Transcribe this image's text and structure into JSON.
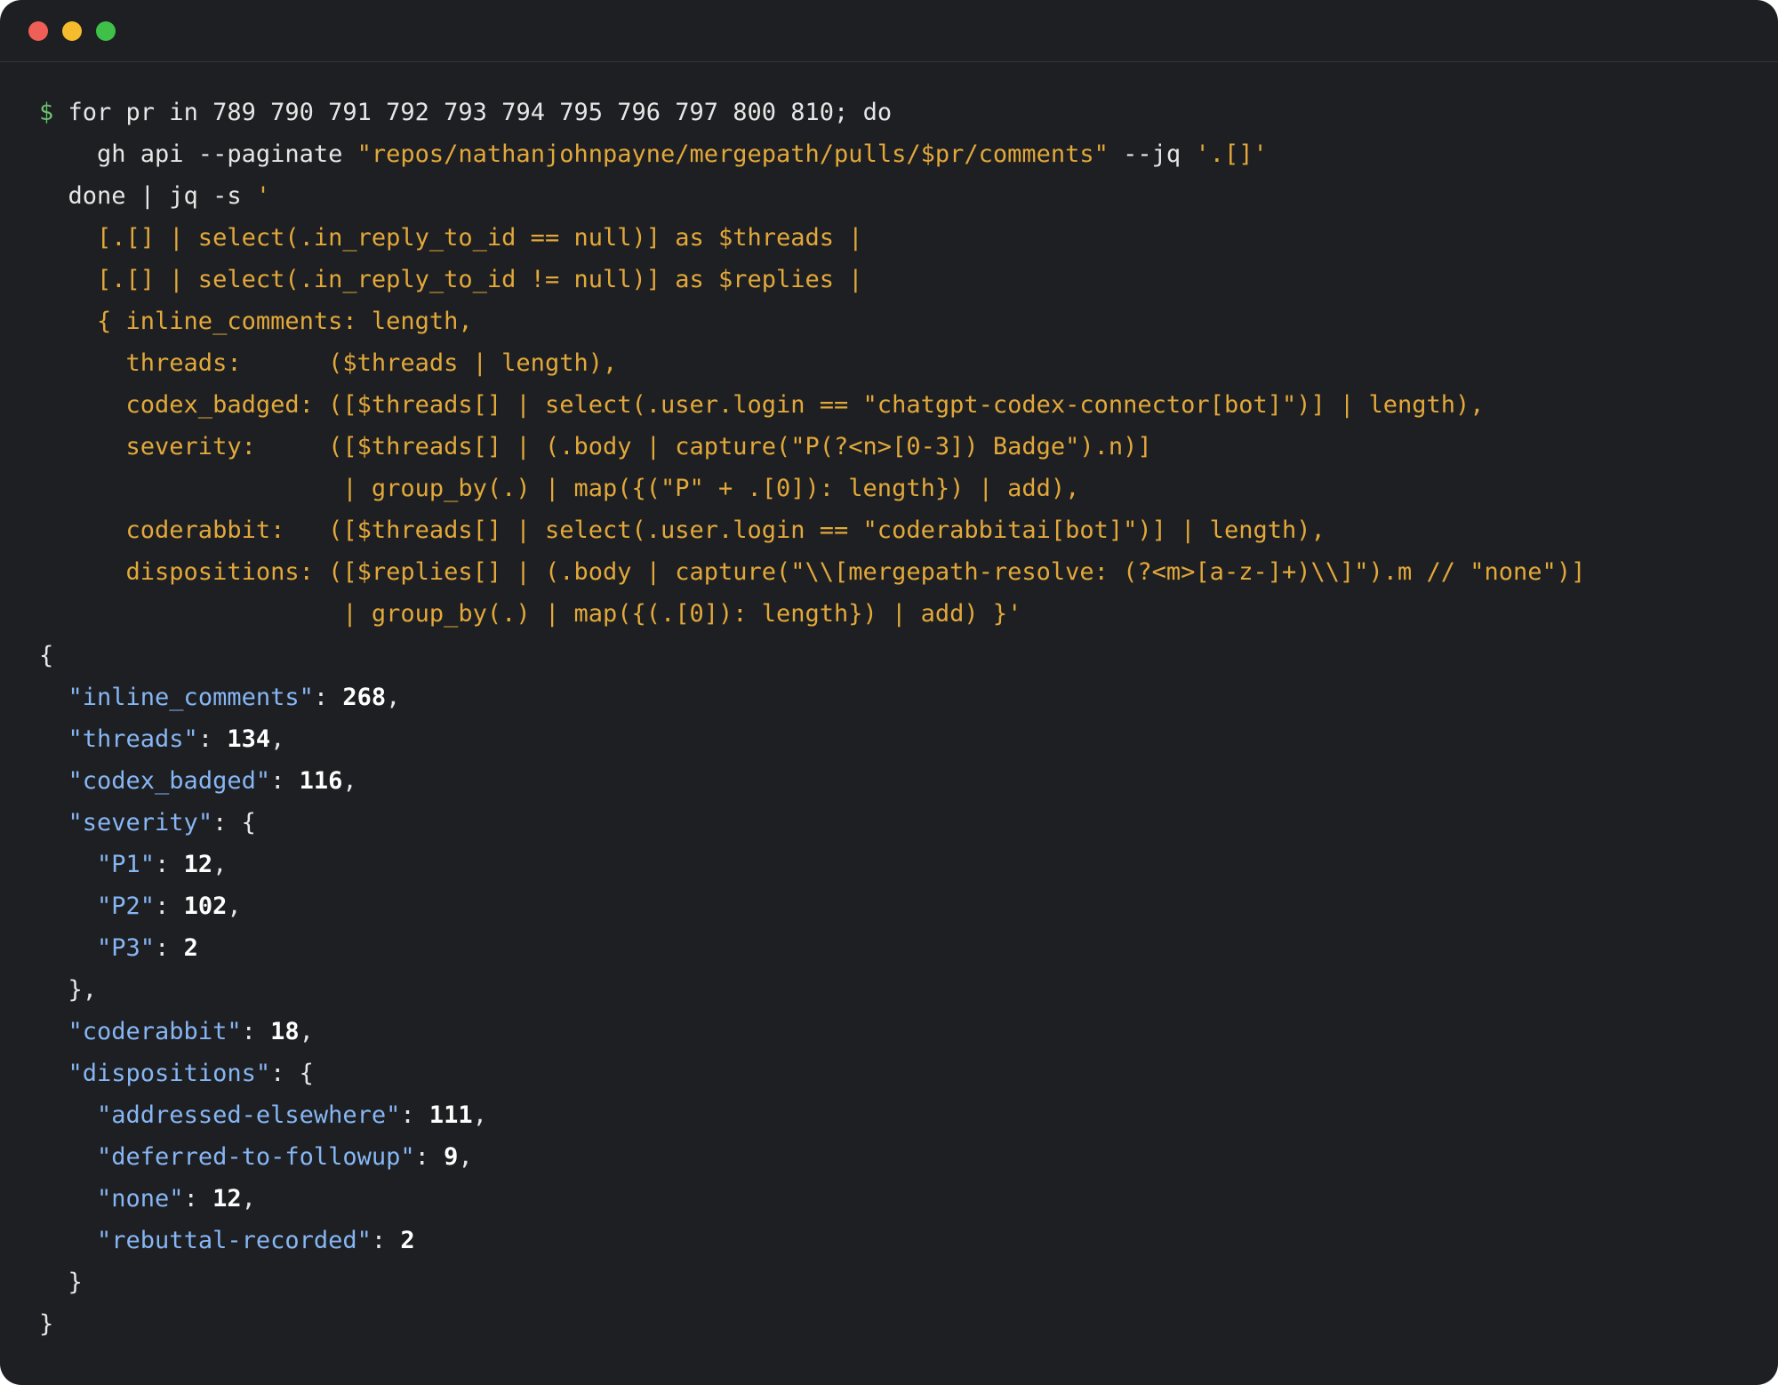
{
  "window": {
    "controls": [
      "close",
      "minimize",
      "zoom"
    ],
    "colors": {
      "close": "#ee5f57",
      "minimize": "#f5bd2e",
      "zoom": "#3fc048"
    }
  },
  "colors": {
    "background": "#1e1f22",
    "prompt": "#6cc070",
    "plain": "#e6e6e6",
    "string": "#e2a83a",
    "json_key": "#86b6f4",
    "json_number": "#ffffff"
  },
  "command": {
    "prompt": "$",
    "lines": [
      " for pr in 789 790 791 792 793 794 795 796 797 800 810; do",
      "    gh api --paginate ",
      "\"repos/nathanjohnpayne/mergepath/pulls/$pr/comments\"",
      " --jq ",
      "'.[]'",
      "  done | jq -s ",
      "'",
      "    [.[] | select(.in_reply_to_id == null)] as $threads |",
      "    [.[] | select(.in_reply_to_id != null)] as $replies |",
      "    { inline_comments: length,",
      "      threads:      ($threads | length),",
      "      codex_badged: ([$threads[] | select(.user.login == \"chatgpt-codex-connector[bot]\")] | length),",
      "      severity:     ([$threads[] | (.body | capture(\"P(?<n>[0-3]) Badge\").n)]",
      "                     | group_by(.) | map({(\"P\" + .[0]): length}) | add),",
      "      coderabbit:   ([$threads[] | select(.user.login == \"coderabbitai[bot]\")] | length),",
      "      dispositions: ([$replies[] | (.body | capture(\"\\\\[mergepath-resolve: (?<m>[a-z-]+)\\\\]\").m // \"none\")]",
      "                     | group_by(.) | map({(.[0]): length}) | add) }'"
    ]
  },
  "output": {
    "open": "{",
    "close": "}",
    "inline_comments": {
      "key": "\"inline_comments\"",
      "value": "268"
    },
    "threads": {
      "key": "\"threads\"",
      "value": "134"
    },
    "codex_badged": {
      "key": "\"codex_badged\"",
      "value": "116"
    },
    "severity": {
      "key": "\"severity\"",
      "open": ": {",
      "close": "  },",
      "P1": {
        "key": "\"P1\"",
        "value": "12"
      },
      "P2": {
        "key": "\"P2\"",
        "value": "102"
      },
      "P3": {
        "key": "\"P3\"",
        "value": "2"
      }
    },
    "coderabbit": {
      "key": "\"coderabbit\"",
      "value": "18"
    },
    "dispositions": {
      "key": "\"dispositions\"",
      "open": ": {",
      "close": "  }",
      "addressed_elsewhere": {
        "key": "\"addressed-elsewhere\"",
        "value": "111"
      },
      "deferred_to_followup": {
        "key": "\"deferred-to-followup\"",
        "value": "9"
      },
      "none": {
        "key": "\"none\"",
        "value": "12"
      },
      "rebuttal_recorded": {
        "key": "\"rebuttal-recorded\"",
        "value": "2"
      }
    }
  }
}
